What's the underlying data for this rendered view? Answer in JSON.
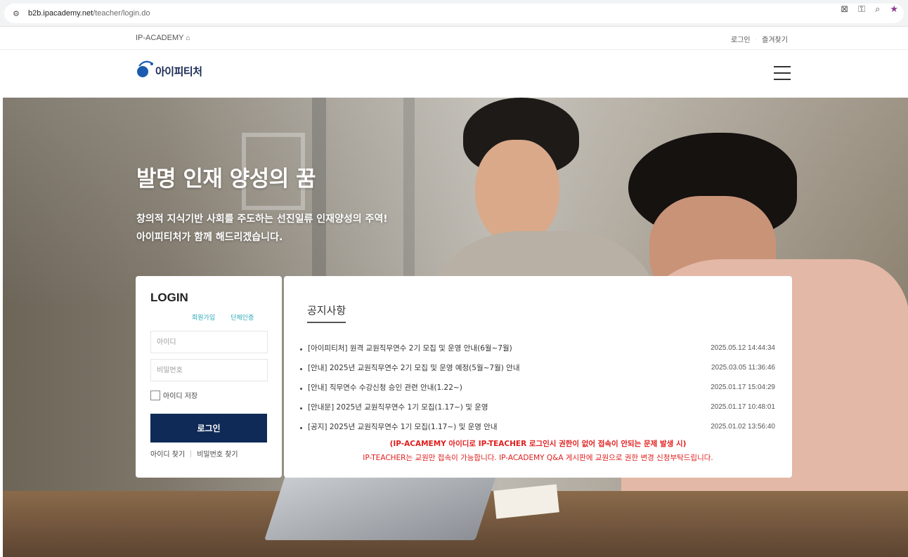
{
  "browser": {
    "url_domain": "b2b.ipacademy.net",
    "url_path": "/teacher/login.do"
  },
  "top_nav": {
    "brand": "IP-ACADEMY",
    "login_link": "로그인",
    "favorite_link": "즐겨찾기"
  },
  "header": {
    "logo_text": "아이피티처"
  },
  "hero": {
    "title": "발명 인재 양성의 꿈",
    "subtitle_line1": "창의적 지식기반 사회를 주도하는 선진일류 인재양성의 주역!",
    "subtitle_line2": "아이피티처가 함께 해드리겠습니다."
  },
  "login": {
    "title": "LOGIN",
    "signup_link": "회원가입",
    "group_auth_link": "단체인증",
    "id_placeholder": "아이디",
    "pw_placeholder": "비밀번호",
    "save_id_label": "아이디 저장",
    "login_button": "로그인",
    "find_id_link": "아이디 찾기",
    "find_pw_link": "비밀번호 찾기"
  },
  "notice": {
    "title": "공지사항",
    "items": [
      {
        "title": "[아이피티처] 원격 교원직무연수 2기 모집 및 운영 안내(6월~7월)",
        "date": "2025.05.12 14:44:34"
      },
      {
        "title": "[안내] 2025년 교원직무연수 2기 모집 및 운영 예정(5월~7월) 안내",
        "date": "2025.03.05 11:36:46"
      },
      {
        "title": "[안내] 직무연수 수강신청 승인 관련 안내(1.22~)",
        "date": "2025.01.17 15:04:29"
      },
      {
        "title": "[안내문] 2025년 교원직무연수 1기 모집(1.17~) 및 운영",
        "date": "2025.01.17 10:48:01"
      },
      {
        "title": "[공지] 2025년 교원직무연수 1기 모집(1.17~) 및 운영 안내",
        "date": "2025.01.02 13:56:40"
      }
    ],
    "warning_line1": "(IP-ACAMEMY 아이디로 IP-TEACHER 로그인시 권한이 없어 접속이 안되는 문제 발생 시)",
    "warning_line2": "IP-TEACHER는 교원만 접속이 가능합니다. IP-ACADEMY Q&A 게시판에 교원으로 권한 변경 신청부탁드립니다."
  },
  "colors": {
    "login_button_bg": "#0f2a56",
    "link_teal": "#2aa8b8",
    "warning_red": "#e01e1e",
    "logo_blue": "#1a5bb0"
  }
}
